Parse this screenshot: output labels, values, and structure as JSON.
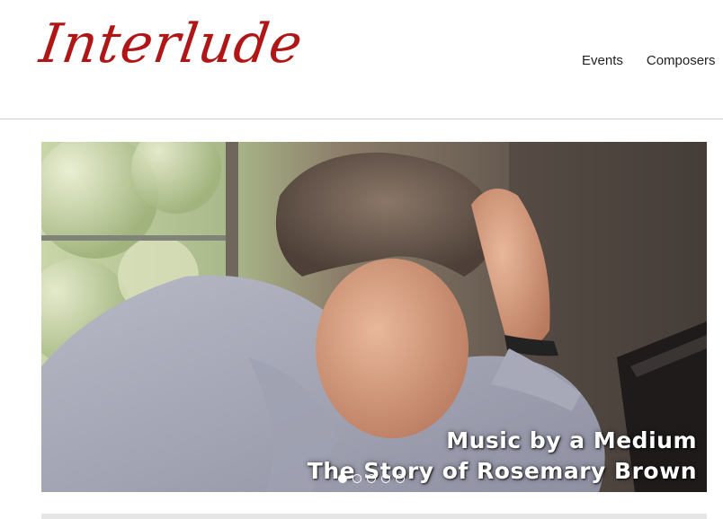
{
  "site": {
    "logo_text": "Interlude",
    "brand_color": "#b01616"
  },
  "nav": {
    "items": [
      {
        "label": "Events"
      },
      {
        "label": "Composers"
      }
    ]
  },
  "hero": {
    "caption_line1": "Music by a Medium",
    "caption_line2": "The Story of Rosemary Brown",
    "slide_count": 5,
    "active_slide": 1
  }
}
